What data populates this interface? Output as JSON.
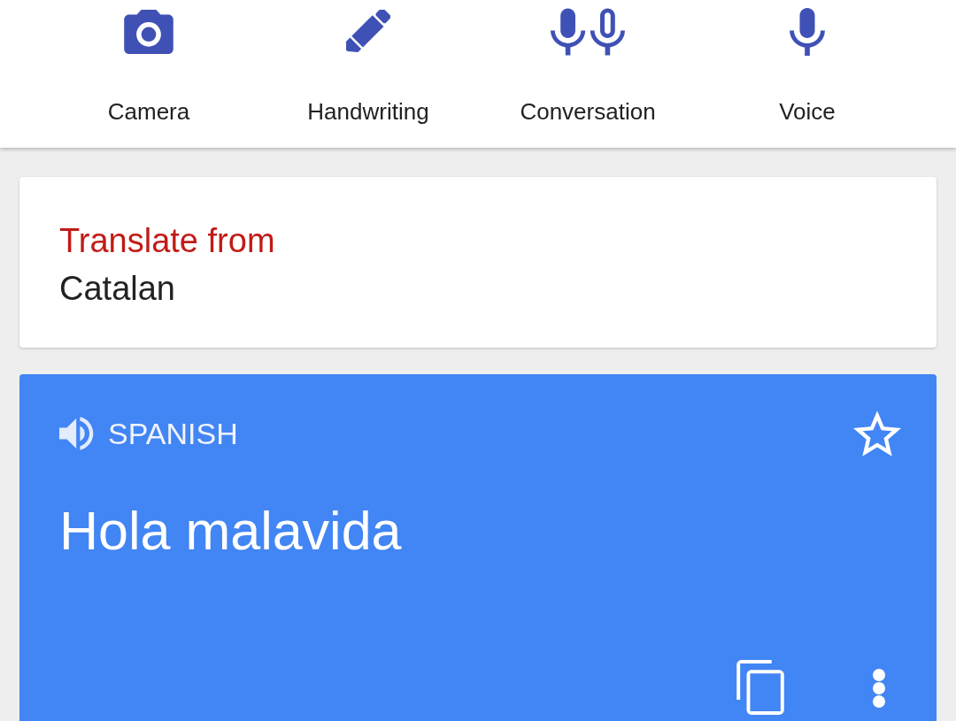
{
  "input_tools": [
    {
      "kind": "camera",
      "label": "Camera"
    },
    {
      "kind": "handwriting",
      "label": "Handwriting"
    },
    {
      "kind": "conversation",
      "label": "Conversation"
    },
    {
      "kind": "voice",
      "label": "Voice"
    }
  ],
  "source_card": {
    "heading": "Translate from",
    "language": "Catalan"
  },
  "result_card": {
    "language": "SPANISH",
    "starred": false,
    "translation": "Hola malavida"
  }
}
